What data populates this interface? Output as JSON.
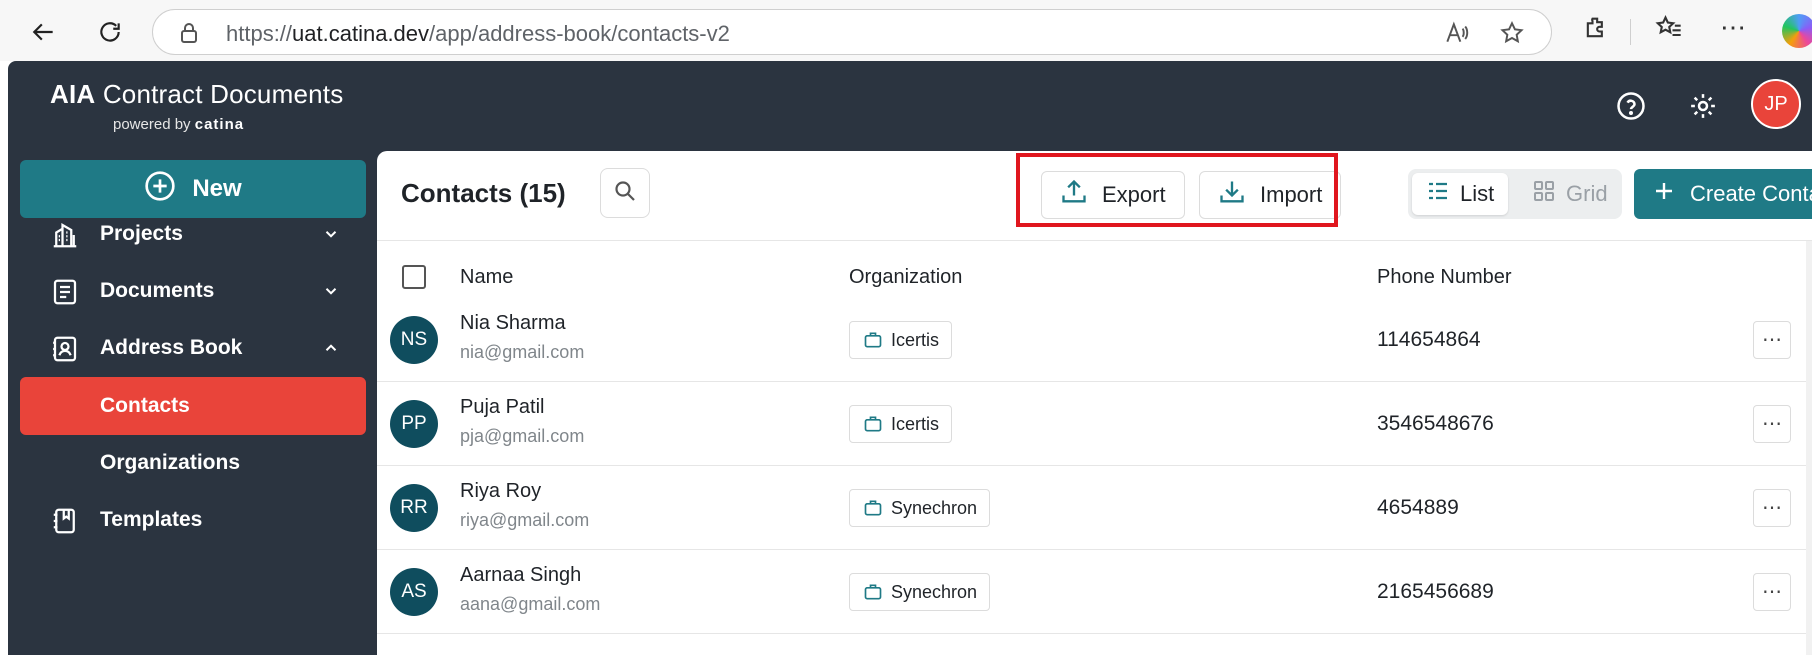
{
  "browser": {
    "url_prefix": "https://",
    "url_host": "uat.catina.dev",
    "url_path": "/app/address-book/contacts-v2"
  },
  "brand": {
    "title_bold": "AIA",
    "title_rest": " Contract Documents",
    "powered_by": "powered by",
    "powered_name": "catina"
  },
  "user": {
    "initials": "JP"
  },
  "sidebar": {
    "new_label": "New",
    "items": [
      {
        "label": "Projects",
        "icon": "building-icon",
        "chevron": "down"
      },
      {
        "label": "Documents",
        "icon": "document-icon",
        "chevron": "down"
      },
      {
        "label": "Address Book",
        "icon": "address-book-icon",
        "chevron": "up"
      },
      {
        "label": "Contacts",
        "active": true
      },
      {
        "label": "Organizations"
      },
      {
        "label": "Templates",
        "icon": "template-icon"
      }
    ]
  },
  "main": {
    "title": "Contacts (15)",
    "export_label": "Export",
    "import_label": "Import",
    "list_label": "List",
    "grid_label": "Grid",
    "create_label": "Create Contact",
    "columns": {
      "name": "Name",
      "organization": "Organization",
      "phone": "Phone Number"
    },
    "rows": [
      {
        "initials": "NS",
        "name": "Nia Sharma",
        "email": "nia@gmail.com",
        "org": "Icertis",
        "phone": "114654864"
      },
      {
        "initials": "PP",
        "name": "Puja Patil",
        "email": "pja@gmail.com",
        "org": "Icertis",
        "phone": "3546548676"
      },
      {
        "initials": "RR",
        "name": "Riya Roy",
        "email": "riya@gmail.com",
        "org": "Synechron",
        "phone": "4654889"
      },
      {
        "initials": "AS",
        "name": "Aarnaa Singh",
        "email": "aana@gmail.com",
        "org": "Synechron",
        "phone": "2165456689"
      }
    ]
  },
  "colors": {
    "teal": "#1f7a86",
    "sidebar_bg": "#2b3440",
    "active_red": "#e9443a",
    "avatar_bg": "#0f4d5e",
    "highlight": "#e0161e"
  }
}
